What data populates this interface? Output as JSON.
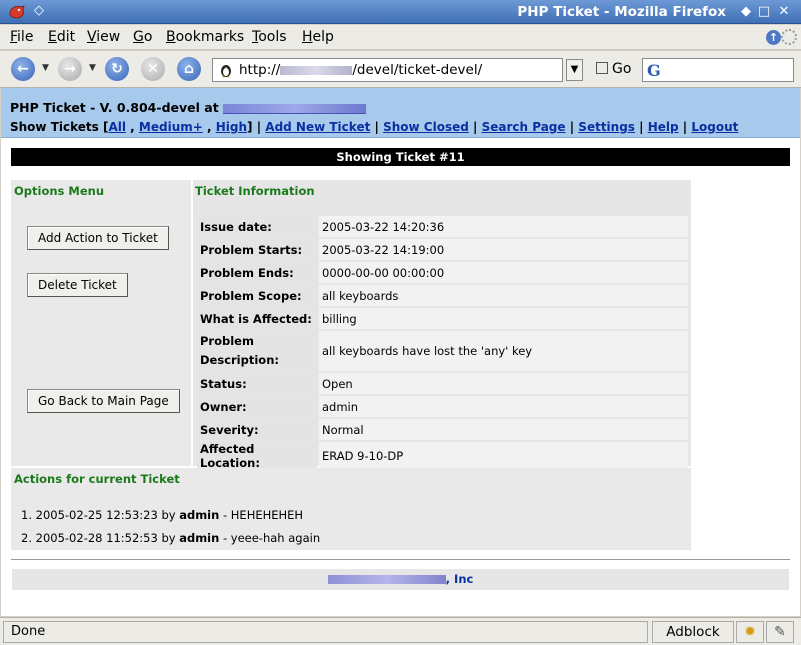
{
  "window": {
    "title": "PHP Ticket - Mozilla Firefox",
    "win_menu_glyph": "◇",
    "controls": [
      "◆",
      "□",
      "✕"
    ]
  },
  "menubar": {
    "items": [
      {
        "label": "File",
        "accel": "F",
        "rest": "ile"
      },
      {
        "label": "Edit",
        "accel": "E",
        "rest": "dit"
      },
      {
        "label": "View",
        "accel": "V",
        "rest": "iew"
      },
      {
        "label": "Go",
        "accel": "G",
        "rest": "o"
      },
      {
        "label": "Bookmarks",
        "accel": "B",
        "rest": "ookmarks"
      },
      {
        "label": "Tools",
        "accel": "T",
        "rest": "ools"
      },
      {
        "label": "Help",
        "accel": "H",
        "rest": "elp"
      }
    ]
  },
  "navbar": {
    "url_prefix": "http://",
    "url_suffix": "/devel/ticket-devel/",
    "go_label": "Go",
    "search_engine_glyph": "G"
  },
  "header": {
    "title_prefix": "PHP Ticket - V. 0.804-devel at",
    "show_tickets_label": "Show Tickets",
    "links": {
      "all": "All",
      "medium": "Medium+",
      "high": "High",
      "add_new_ticket": "Add New Ticket",
      "show_closed": "Show Closed",
      "search_page": "Search Page",
      "settings": "Settings",
      "help": "Help",
      "logout": "Logout"
    }
  },
  "showing": "Showing Ticket #11",
  "options_menu": {
    "title": "Options Menu",
    "add_action": "Add Action to Ticket",
    "delete_ticket": "Delete Ticket",
    "back_main": "Go Back to Main Page"
  },
  "ticket_info": {
    "title": "Ticket Information",
    "rows": [
      {
        "label": "Issue date:",
        "value": "2005-03-22 14:20:36"
      },
      {
        "label": "Problem Starts:",
        "value": "2005-03-22 14:19:00"
      },
      {
        "label": "Problem Ends:",
        "value": "0000-00-00 00:00:00"
      },
      {
        "label": "Problem Scope:",
        "value": "all keyboards"
      },
      {
        "label": "What is Affected:",
        "value": "billing"
      },
      {
        "label_line1": "Problem",
        "label_line2": "Description:",
        "value": "all keyboards have lost the 'any' key"
      },
      {
        "label": "Status:",
        "value": "Open"
      },
      {
        "label": "Owner:",
        "value": "admin"
      },
      {
        "label": "Severity:",
        "value": "Normal"
      },
      {
        "label": "Affected Location:",
        "value": "ERAD 9-10-DP"
      }
    ]
  },
  "actions": {
    "title": "Actions for current Ticket",
    "items": [
      {
        "num": "1.",
        "date": "2005-02-25 12:53:23",
        "by": "by",
        "user": "admin",
        "text": "- HEHEHEHEH"
      },
      {
        "num": "2.",
        "date": "2005-02-28 11:52:53",
        "by": "by",
        "user": "admin",
        "text": "- yeee-hah again"
      }
    ]
  },
  "footer": {
    "suffix": ", Inc"
  },
  "statusbar": {
    "status": "Done",
    "adblock": "Adblock",
    "icon1": "✹",
    "icon2": "✎"
  }
}
